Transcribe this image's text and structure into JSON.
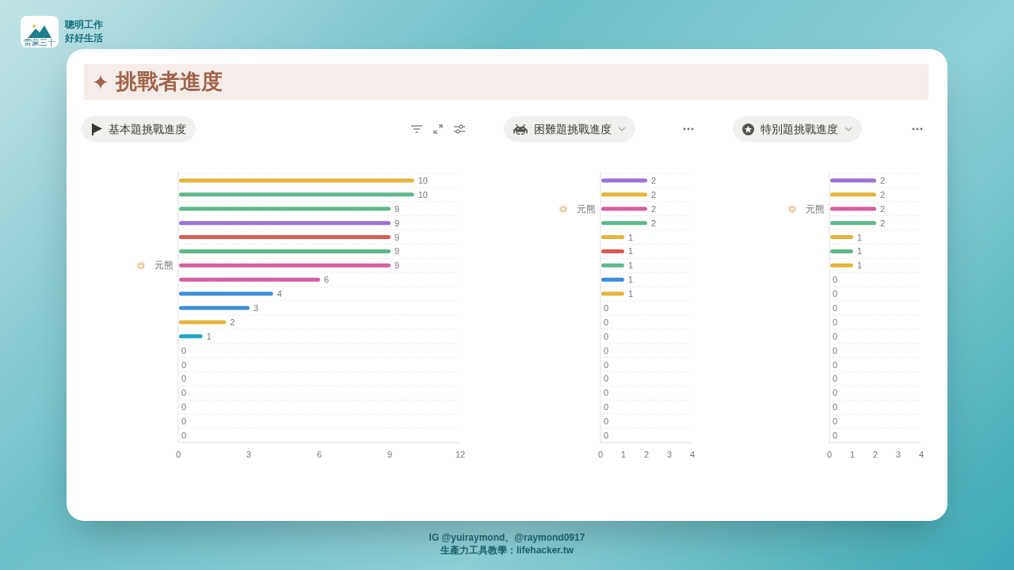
{
  "brand": {
    "logo_text": "雷蒙三十",
    "tagline": [
      "聰明工作",
      "好好生活"
    ]
  },
  "page": {
    "title_icon": "✦",
    "title": "挑戰者進度"
  },
  "charts": [
    {
      "kind": "flag",
      "title": "基本題挑戰進度",
      "hovered": true,
      "chart_data": {
        "type": "bar",
        "orientation": "horizontal",
        "categories": [
          null,
          null,
          null,
          null,
          null,
          null,
          "元熊",
          null,
          null,
          null,
          null,
          null,
          null,
          null,
          null,
          null,
          null,
          null,
          null
        ],
        "series": [
          {
            "values": [
              10,
              10,
              9,
              9,
              9,
              9,
              9,
              6,
              4,
              3,
              2,
              1,
              0,
              0,
              0,
              0,
              0,
              0,
              0
            ],
            "colors": [
              "#e5b43a",
              "#5fb88b",
              "#5fb88b",
              "#9b72d4",
              "#d95c55",
              "#5fb88b",
              "#d65fa0",
              "#d65fa0",
              "#3a8fdc",
              "#3a8fdc",
              "#e5b43a",
              "#1aa6c4",
              null,
              null,
              null,
              null,
              null,
              null,
              null
            ]
          }
        ],
        "xlim": [
          0,
          12
        ],
        "xticks": [
          0,
          3,
          6,
          9,
          12
        ],
        "data_labels": true
      }
    },
    {
      "kind": "invader",
      "title": "困難題挑戰進度",
      "hovered": false,
      "chart_data": {
        "type": "bar",
        "orientation": "horizontal",
        "categories": [
          null,
          null,
          "元熊",
          null,
          null,
          null,
          null,
          null,
          null,
          null,
          null,
          null,
          null,
          null,
          null,
          null,
          null,
          null,
          null
        ],
        "series": [
          {
            "values": [
              2,
              2,
              2,
              2,
              1,
              1,
              1,
              1,
              1,
              0,
              0,
              0,
              0,
              0,
              0,
              0,
              0,
              0,
              0
            ],
            "colors": [
              "#9b72d4",
              "#e5b43a",
              "#d65fa0",
              "#5fb88b",
              "#e5b43a",
              "#d95c55",
              "#5fb88b",
              "#3a8fdc",
              "#e5b43a",
              null,
              null,
              null,
              null,
              null,
              null,
              null,
              null,
              null,
              null
            ]
          }
        ],
        "xlim": [
          0,
          4
        ],
        "xticks": [
          0,
          1,
          2,
          3,
          4
        ],
        "data_labels": true
      }
    },
    {
      "kind": "star",
      "title": "特別題挑戰進度",
      "hovered": false,
      "chart_data": {
        "type": "bar",
        "orientation": "horizontal",
        "categories": [
          null,
          null,
          "元熊",
          null,
          null,
          null,
          null,
          null,
          null,
          null,
          null,
          null,
          null,
          null,
          null,
          null,
          null,
          null,
          null
        ],
        "series": [
          {
            "values": [
              2,
              2,
              2,
              2,
              1,
              1,
              1,
              0,
              0,
              0,
              0,
              0,
              0,
              0,
              0,
              0,
              0,
              0,
              0
            ],
            "colors": [
              "#9b72d4",
              "#e5b43a",
              "#d65fa0",
              "#5fb88b",
              "#e5b43a",
              "#5fb88b",
              "#e5b43a",
              null,
              null,
              null,
              null,
              null,
              null,
              null,
              null,
              null,
              null,
              null,
              null
            ]
          }
        ],
        "xlim": [
          0,
          4
        ],
        "xticks": [
          0,
          1,
          2,
          3,
          4
        ],
        "data_labels": true
      }
    }
  ],
  "footer": {
    "lines": [
      "IG @yuiraymond、@raymond0917",
      "生產力工具教學：lifehacker.tw"
    ]
  }
}
